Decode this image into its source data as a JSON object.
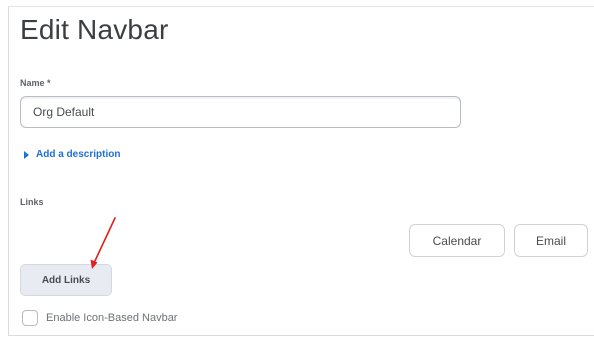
{
  "page": {
    "title": "Edit Navbar"
  },
  "name_field": {
    "label": "Name *",
    "value": "Org Default"
  },
  "description_toggle": {
    "label": "Add a description"
  },
  "links": {
    "label": "Links",
    "items": [
      {
        "label": "Calendar"
      },
      {
        "label": "Email"
      }
    ],
    "add_button_label": "Add Links"
  },
  "icon_navbar": {
    "label": "Enable Icon-Based Navbar",
    "checked": false
  },
  "annotation": {
    "arrow_color": "#e0201c",
    "icon": "red-arrow-icon"
  },
  "colors": {
    "accent": "#1e6fd9",
    "title_text": "#3b3f42",
    "body_text": "#494c4e",
    "button_bg": "#e8ecf2"
  }
}
